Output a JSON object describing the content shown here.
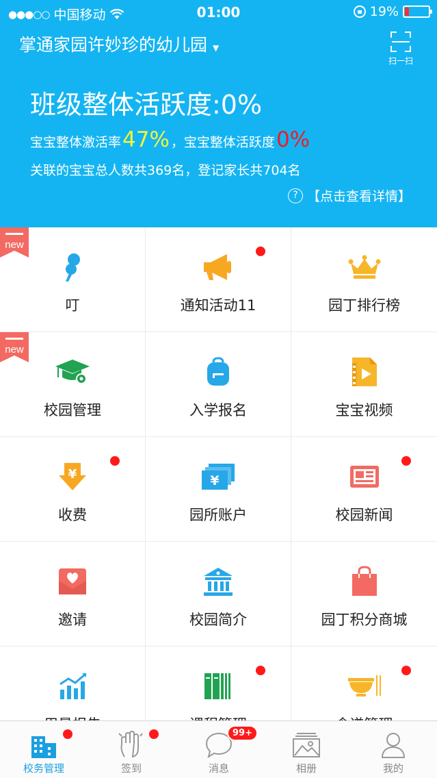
{
  "status_bar": {
    "carrier": "中国移动",
    "time": "01:00",
    "battery_pct": "19%",
    "battery_level": 0.19,
    "battery_color": "#ff2d2d"
  },
  "header": {
    "kindergarten_name": "掌通家园许妙珍的幼儿园",
    "scan_label": "扫一扫",
    "activity_title": "班级整体活跃度:0%",
    "activation_prefix": "宝宝整体激活率",
    "activation_value": "47%",
    "activity_prefix": "，宝宝整体活跃度",
    "activity_value": "0%",
    "summary": "关联的宝宝总人数共369名，登记家长共704名",
    "detail_link": "【点击查看详情】",
    "background_color": "#14b4f2"
  },
  "grid": {
    "new_tag_text": "new",
    "items": [
      {
        "label": "叮",
        "icon": "pin-icon",
        "new": true,
        "dot": false
      },
      {
        "label": "通知活动11",
        "icon": "megaphone-icon",
        "new": false,
        "dot": true
      },
      {
        "label": "园丁排行榜",
        "icon": "crown-icon",
        "new": false,
        "dot": false
      },
      {
        "label": "校园管理",
        "icon": "graduation-cap-icon",
        "new": true,
        "dot": false
      },
      {
        "label": "入学报名",
        "icon": "backpack-icon",
        "new": false,
        "dot": false
      },
      {
        "label": "宝宝视频",
        "icon": "video-file-icon",
        "new": false,
        "dot": false
      },
      {
        "label": "收费",
        "icon": "yuan-arrow-icon",
        "new": false,
        "dot": true
      },
      {
        "label": "园所账户",
        "icon": "money-stack-icon",
        "new": false,
        "dot": false
      },
      {
        "label": "校园新闻",
        "icon": "newspaper-icon",
        "new": false,
        "dot": true
      },
      {
        "label": "邀请",
        "icon": "heart-envelope-icon",
        "new": false,
        "dot": false
      },
      {
        "label": "校园简介",
        "icon": "building-icon",
        "new": false,
        "dot": false
      },
      {
        "label": "园丁积分商城",
        "icon": "shopping-bag-icon",
        "new": false,
        "dot": false
      },
      {
        "label": "用量报告",
        "icon": "bar-chart-icon",
        "new": false,
        "dot": false
      },
      {
        "label": "课程管理",
        "icon": "books-icon",
        "new": false,
        "dot": true
      },
      {
        "label": "食谱管理",
        "icon": "bowl-icon",
        "new": false,
        "dot": true
      }
    ]
  },
  "tabbar": {
    "tabs": [
      {
        "label": "校务管理",
        "icon": "school-building-icon",
        "active": true,
        "dot": true
      },
      {
        "label": "签到",
        "icon": "hand-icon",
        "active": false,
        "dot": true
      },
      {
        "label": "消息",
        "icon": "chat-bubble-icon",
        "active": false,
        "badge": "99+"
      },
      {
        "label": "相册",
        "icon": "photo-album-icon",
        "active": false
      },
      {
        "label": "我的",
        "icon": "user-icon",
        "active": false
      }
    ]
  }
}
